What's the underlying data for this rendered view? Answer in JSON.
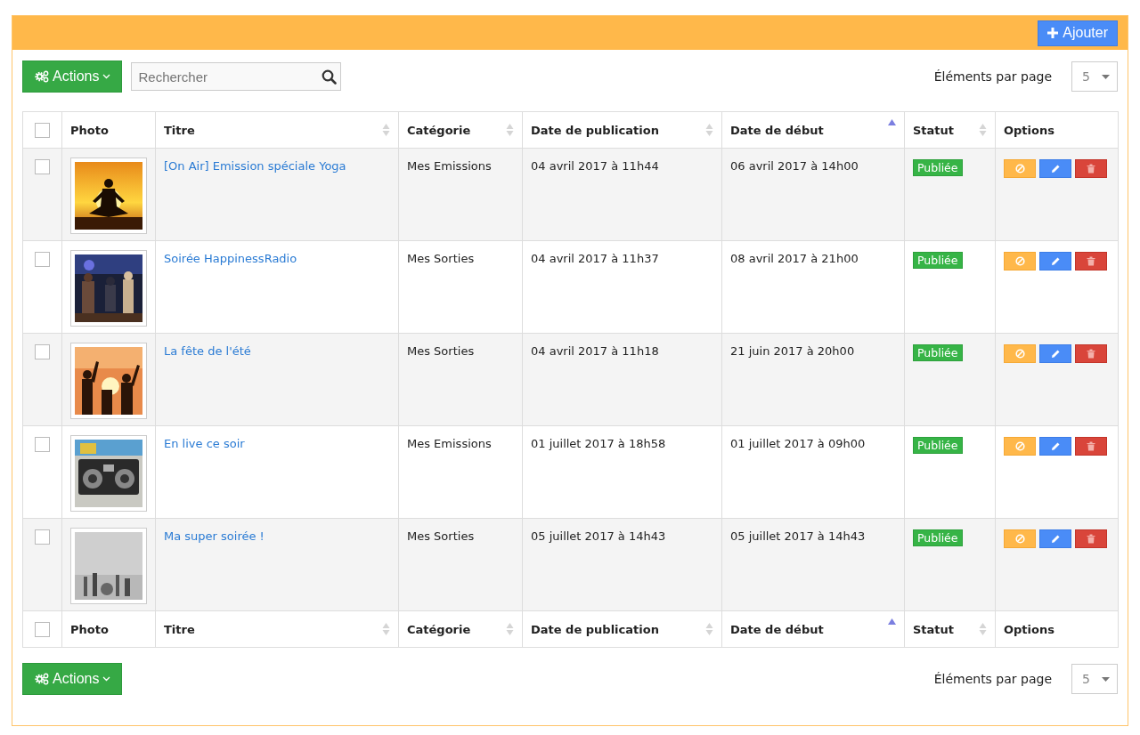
{
  "header": {
    "add_button": "Ajouter"
  },
  "toolbar": {
    "actions_label": "Actions",
    "search": {
      "placeholder": "Rechercher"
    },
    "per_page_label": "Éléments par page",
    "per_page_value": "5"
  },
  "table": {
    "select_all_checked": false,
    "columns": [
      {
        "label": "Photo",
        "sortable": false
      },
      {
        "label": "Titre",
        "sortable": true,
        "sort_ascending": false
      },
      {
        "label": "Catégorie",
        "sortable": true,
        "sort_ascending": false
      },
      {
        "label": "Date de publication",
        "sortable": true,
        "sort_ascending": false
      },
      {
        "label": "Date de début",
        "sortable": true,
        "sort_ascending": true
      },
      {
        "label": "Statut",
        "sortable": true,
        "sort_ascending": false
      },
      {
        "label": "Options",
        "sortable": false
      }
    ],
    "rows": [
      {
        "checked": false,
        "title": "[On Air] Emission spéciale Yoga",
        "category": "Mes Emissions",
        "published": "04 avril 2017 à 11h44",
        "start": "06 avril 2017 à 14h00",
        "status": "Publiée"
      },
      {
        "checked": false,
        "title": "Soirée HappinessRadio",
        "category": "Mes Sorties",
        "published": "04 avril 2017 à 11h37",
        "start": "08 avril 2017 à 21h00",
        "status": "Publiée"
      },
      {
        "checked": false,
        "title": "La fête de l'été",
        "category": "Mes Sorties",
        "published": "04 avril 2017 à 11h18",
        "start": "21 juin 2017 à 20h00",
        "status": "Publiée"
      },
      {
        "checked": false,
        "title": "En live ce soir",
        "category": "Mes Emissions",
        "published": "01 juillet 2017 à 18h58",
        "start": "01 juillet 2017 à 09h00",
        "status": "Publiée"
      },
      {
        "checked": false,
        "title": "Ma super soirée !",
        "category": "Mes Sorties",
        "published": "05 juillet 2017 à 14h43",
        "start": "05 juillet 2017 à 14h43",
        "status": "Publiée"
      }
    ],
    "footer_select_all_checked": false,
    "footer_columns": [
      {
        "label": "Photo",
        "sortable": false
      },
      {
        "label": "Titre",
        "sortable": true,
        "sort_ascending": false
      },
      {
        "label": "Catégorie",
        "sortable": true,
        "sort_ascending": false
      },
      {
        "label": "Date de publication",
        "sortable": true,
        "sort_ascending": false
      },
      {
        "label": "Date de début",
        "sortable": true,
        "sort_ascending": true
      },
      {
        "label": "Statut",
        "sortable": true,
        "sort_ascending": false
      },
      {
        "label": "Options",
        "sortable": false
      }
    ]
  },
  "bottom_toolbar": {
    "actions_label": "Actions",
    "per_page_label": "Éléments par page",
    "per_page_value": "5"
  }
}
